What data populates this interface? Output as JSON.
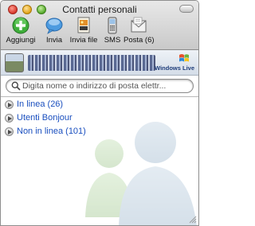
{
  "window": {
    "title": "Contatti personali"
  },
  "toolbar": {
    "items": [
      {
        "label": "Aggiungi",
        "icon": "add-contact-icon"
      },
      {
        "label": "Invia",
        "icon": "chat-bubble-icon"
      },
      {
        "label": "Invia file",
        "icon": "send-file-icon"
      },
      {
        "label": "SMS",
        "icon": "mobile-phone-icon"
      },
      {
        "label": "Posta (6)",
        "icon": "mail-icon"
      }
    ]
  },
  "banner": {
    "logo_text": "Windows Live"
  },
  "search": {
    "placeholder": "Digita nome o indirizzo di posta elettr...",
    "value": ""
  },
  "groups": [
    {
      "label": "In linea (26)"
    },
    {
      "label": "Utenti Bonjour"
    },
    {
      "label": "Non in linea (101)"
    }
  ],
  "colors": {
    "link_blue": "#1a4fbf",
    "titlebar": "#c9c9c9"
  }
}
